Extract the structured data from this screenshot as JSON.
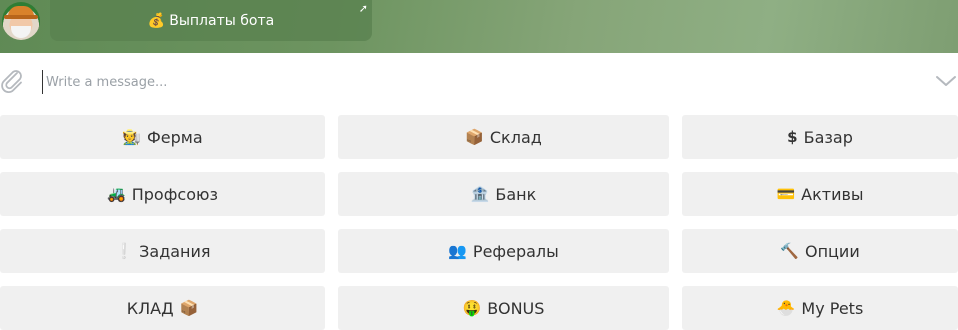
{
  "header": {
    "payout_button": {
      "icon": "money-bag-icon",
      "emoji": "💰",
      "label": "Выплаты бота"
    }
  },
  "composer": {
    "placeholder": "Write a message..."
  },
  "keyboard": {
    "rows": [
      [
        {
          "label": "Ферма",
          "emoji": "🧑‍🌾",
          "icon": "farmer-icon"
        },
        {
          "label": "Склад",
          "emoji": "📦",
          "icon": "package-icon"
        },
        {
          "label": "Базар",
          "emoji": "$",
          "icon": "dollar-icon"
        }
      ],
      [
        {
          "label": "Профсоюз",
          "emoji": "🚜",
          "icon": "tractor-icon"
        },
        {
          "label": "Банк",
          "emoji": "🏦",
          "icon": "bank-icon"
        },
        {
          "label": "Активы",
          "emoji": "💳",
          "icon": "credit-card-icon"
        }
      ],
      [
        {
          "label": "Задания",
          "emoji": "❕",
          "icon": "exclamation-icon"
        },
        {
          "label": "Рефералы",
          "emoji": "👥",
          "icon": "people-icon"
        },
        {
          "label": "Опции",
          "emoji": "🔨",
          "icon": "hammer-icon"
        }
      ],
      [
        {
          "label": "КЛАД",
          "emoji": "📦",
          "icon": "package-icon",
          "emoji_after": true
        },
        {
          "label": "BONUS",
          "emoji": "🤑",
          "icon": "money-face-icon"
        },
        {
          "label": "My Pets",
          "emoji": "🐣",
          "icon": "hatching-chick-icon"
        }
      ]
    ]
  }
}
